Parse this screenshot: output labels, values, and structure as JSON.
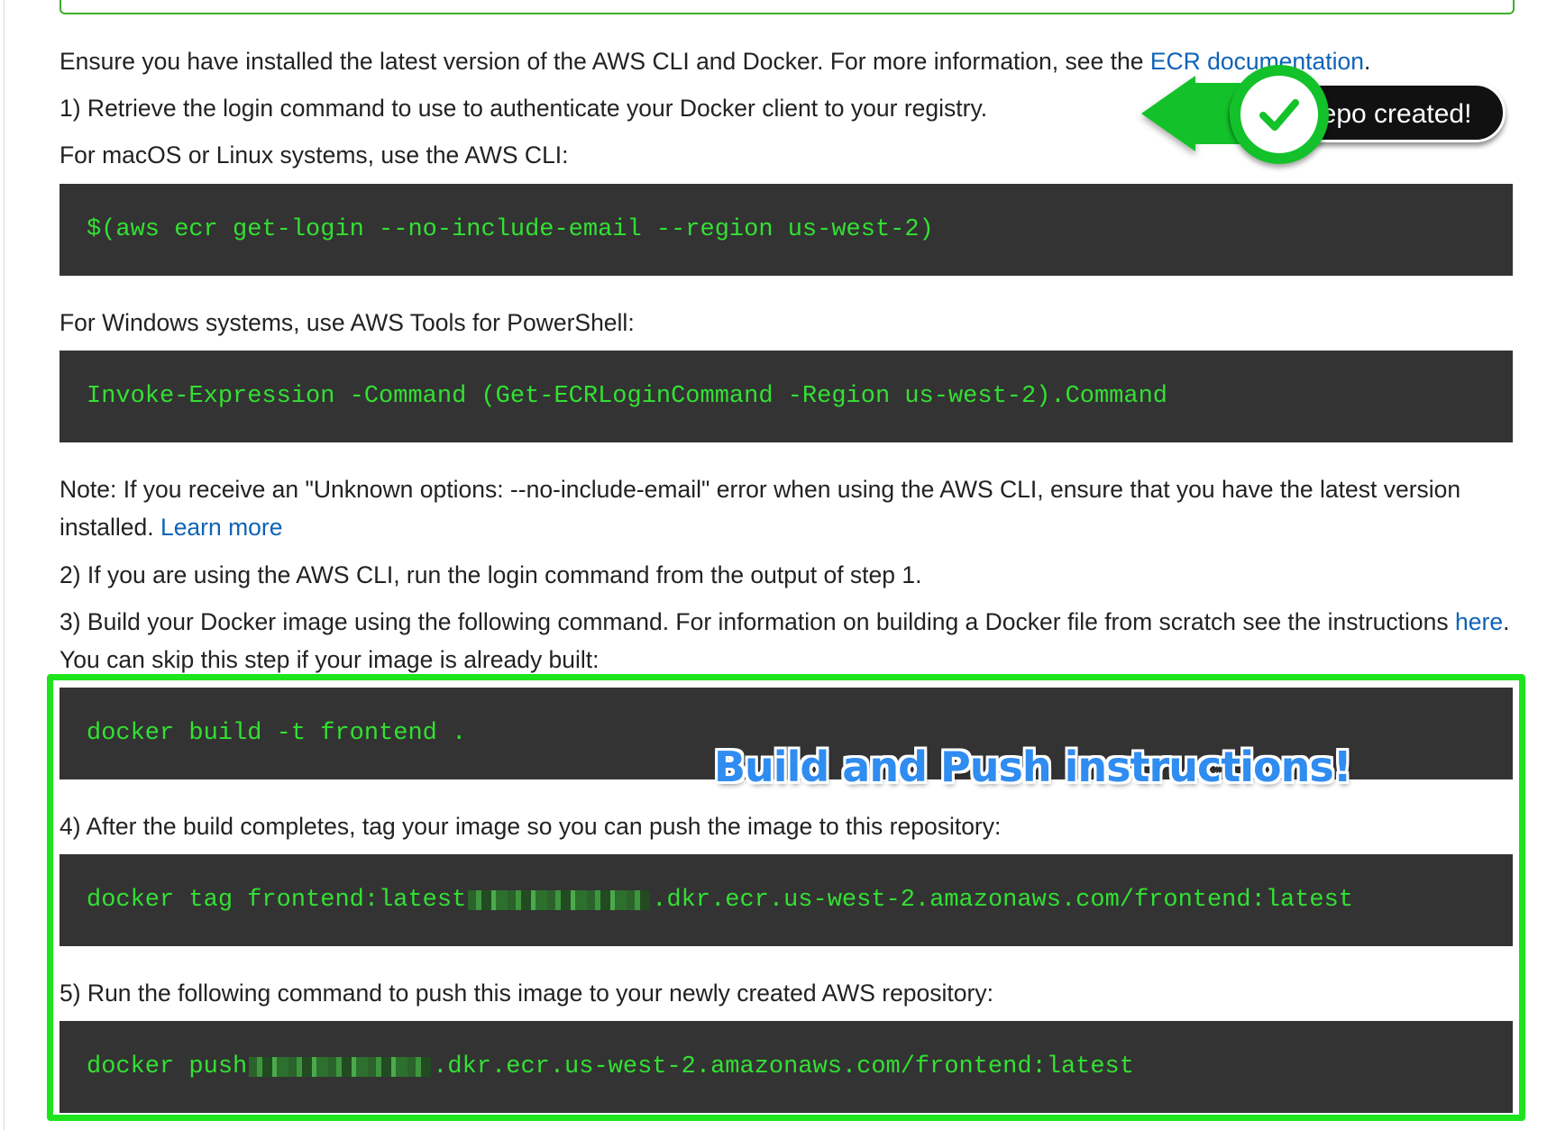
{
  "intro": {
    "text": "Ensure you have installed the latest version of the AWS CLI and Docker. For more information, see the ",
    "link": "ECR documentation",
    "end": "."
  },
  "step1": {
    "text": "1) Retrieve the login command to use to authenticate your Docker client to your registry.",
    "mac_label": "For macOS or Linux systems, use the AWS CLI:",
    "mac_command": "$(aws ecr get-login --no-include-email --region us-west-2)",
    "windows_label": "For Windows systems, use AWS Tools for PowerShell:",
    "windows_command": "Invoke-Expression -Command (Get-ECRLoginCommand -Region us-west-2).Command"
  },
  "note": {
    "text": "Note: If you receive an \"Unknown options: --no-include-email\" error when using the AWS CLI, ensure that you have the latest version installed. ",
    "link": "Learn more"
  },
  "step2": {
    "text": "2) If you are using the AWS CLI, run the login command from the output of step 1."
  },
  "step3": {
    "text": "3) Build your Docker image using the following command. For information on building a Docker file from scratch see the instructions ",
    "link": "here",
    "end": ". You can skip this step if your image is already built:",
    "command": "docker build -t frontend ."
  },
  "step4": {
    "text": "4) After the build completes, tag your image so you can push the image to this repository:",
    "command_prefix": "docker tag frontend:latest ",
    "command_suffix": ".dkr.ecr.us-west-2.amazonaws.com/frontend:latest"
  },
  "step5": {
    "text": "5) Run the following command to push this image to your newly created AWS repository:",
    "command_prefix": "docker push ",
    "command_suffix": ".dkr.ecr.us-west-2.amazonaws.com/frontend:latest"
  },
  "badge": {
    "label": "Repo created!",
    "icon": "checkmark-icon"
  },
  "annotation": {
    "text": "Build and Push instructions!"
  },
  "colors": {
    "code_bg": "#333333",
    "code_text": "#33e033",
    "link": "#0e63b6",
    "highlight_box": "#1ee41e",
    "badge_green": "#13c22a",
    "annotation_blue": "#2f8cf0"
  }
}
